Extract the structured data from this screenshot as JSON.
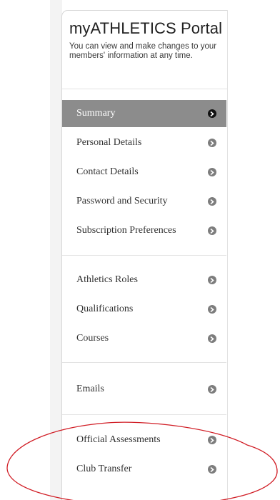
{
  "portal": {
    "title": "myATHLETICS Portal",
    "description": "You can view and make changes to your members' information at any time."
  },
  "menu": {
    "active_index": 0,
    "groups": [
      [
        "Summary",
        "Personal Details",
        "Contact Details",
        "Password and Security",
        "Subscription Preferences"
      ],
      [
        "Athletics Roles",
        "Qualifications",
        "Courses"
      ],
      [
        "Emails"
      ],
      [
        "Official Assessments",
        "Club Transfer"
      ]
    ],
    "items": [
      {
        "label": "Summary"
      },
      {
        "label": "Personal Details"
      },
      {
        "label": "Contact Details"
      },
      {
        "label": "Password and Security"
      },
      {
        "label": "Subscription Preferences"
      },
      {
        "label": "Athletics Roles"
      },
      {
        "label": "Qualifications"
      },
      {
        "label": "Courses"
      },
      {
        "label": "Emails"
      },
      {
        "label": "Official Assessments"
      },
      {
        "label": "Club Transfer"
      }
    ],
    "arrow_icon": "chevron-circle-right-icon"
  },
  "annotation": {
    "color": "#d11f27",
    "highlighted_item": "Club Transfer"
  },
  "colors": {
    "active_background": "#8c8c8c",
    "arrow_grey": "#7d7d7d",
    "active_arrow": "#111111"
  }
}
